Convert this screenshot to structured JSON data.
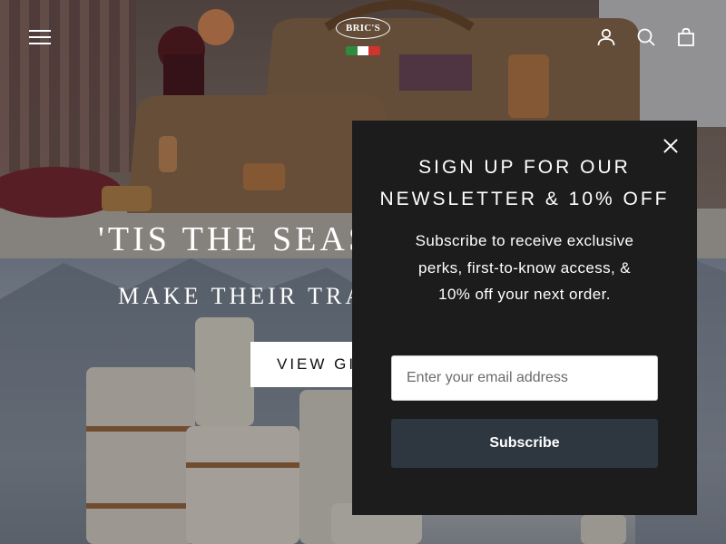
{
  "header": {
    "logo_text": "BRIC'S",
    "flag_colors": [
      "#2e8b3d",
      "#ffffff",
      "#d0342c"
    ],
    "icons": [
      "menu-icon",
      "account-icon",
      "search-icon",
      "cart-bag-icon"
    ]
  },
  "hero": {
    "title": "'TIS THE SEASON",
    "subtitle": "MAKE THEIR TRAVELS",
    "button_label": "VIEW GIFTS"
  },
  "popup": {
    "title_lines": [
      "SIGN UP FOR OUR",
      "NEWSLETTER & 10% OFF"
    ],
    "body_lines": [
      "Subscribe to receive exclusive",
      "perks, first-to-know access, &",
      "10% off your next order."
    ],
    "email_placeholder": "Enter your email address",
    "email_value": "",
    "subscribe_label": "Subscribe",
    "close_icon": "close-icon"
  },
  "colors": {
    "popup_bg": "#1c1c1c",
    "subscribe_bg": "#2e3740",
    "text_light": "#ffffff"
  }
}
